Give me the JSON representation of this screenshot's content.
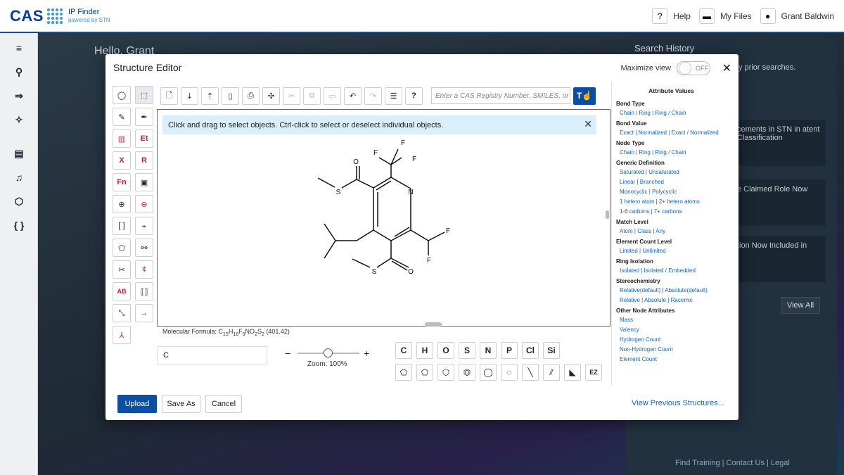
{
  "app": {
    "logo_text": "CAS",
    "product": "IP Finder",
    "powered": "powered by STN"
  },
  "topbar": {
    "help": "Help",
    "files": "My Files",
    "user": "Grant Baldwin"
  },
  "sidebar_icons": [
    "menu-icon",
    "search-icon",
    "arrow-icon",
    "network-icon",
    "doc-icon",
    "bell-icon",
    "hex-icon",
    "braces-icon"
  ],
  "background": {
    "hello": "Hello, Grant",
    "search_history": "Search History",
    "prior_text": "y prior searches.",
    "card1": "cements in STN in atent Classification",
    "card2": "e Claimed Role Now",
    "card3": "tion Now Included in",
    "view_all": "View All",
    "footer": "Find Training | Contact Us | Legal"
  },
  "dialog": {
    "title": "Structure Editor",
    "maximize_label": "Maximize view",
    "toggle_state": "OFF",
    "input_placeholder": "Enter a CAS Registry Number, SMILES, or In",
    "info_message": "Click and drag to select objects. Ctrl-click to select or deselect individual objects.",
    "molecular_formula_prefix": "Molecular Formula: C",
    "molecular_formula_parts": {
      "c": "15",
      "h": "16",
      "f": "5",
      "mw": "(401.42)"
    },
    "atom_input_value": "C",
    "zoom_label": "Zoom: 100%",
    "atoms": [
      "C",
      "H",
      "O",
      "S",
      "N",
      "P",
      "Cl",
      "Si"
    ],
    "buttons": {
      "upload": "Upload",
      "save_as": "Save As",
      "cancel": "Cancel",
      "view_previous": "View Previous Structures..."
    }
  },
  "left_tools": [
    "lasso",
    "select",
    "pencil",
    "pen",
    "chart",
    "Et",
    "X",
    "R",
    "Fn",
    "frame",
    "plus",
    "minus",
    "bracket",
    "chain",
    "ring",
    "bond",
    "scissors",
    "cent",
    "AB",
    "reaction",
    "diag-arrow",
    "arrow",
    "axis"
  ],
  "attributes": {
    "title": "Attribute Values",
    "sections": [
      {
        "name": "Bond Type",
        "lines": [
          "Chain | Ring | Ring / Chain"
        ]
      },
      {
        "name": "Bond Value",
        "lines": [
          "Exact | Normalized | Exact / Normalized"
        ]
      },
      {
        "name": "Node Type",
        "lines": [
          "Chain | Ring | Ring / Chain"
        ]
      },
      {
        "name": "Generic Definition",
        "lines": [
          "Saturated | Unsaturated",
          "Linear | Branched",
          "Monocyclic | Polycyclic",
          "1 hetero atom | 2+ hetero atoms",
          "1-6 carbons | 7+ carbons"
        ]
      },
      {
        "name": "Match Level",
        "lines": [
          "Atom | Class | Any"
        ]
      },
      {
        "name": "Element Count Level",
        "lines": [
          "Limited | Unlimited"
        ]
      },
      {
        "name": "Ring Isolation",
        "lines": [
          "Isolated | Isolated / Embedded"
        ]
      },
      {
        "name": "Stereochemistry",
        "lines": [
          "Relative(default) | Absolute(default)",
          "Relative | Absolute | Racemic"
        ]
      },
      {
        "name": "Other Node Attributes",
        "lines": [
          "Mass",
          "Valency",
          "Hydrogen Count",
          "Non-Hydrogen Count",
          "Element Count"
        ]
      }
    ]
  },
  "molecule_labels": {
    "O1": "O",
    "S1": "S",
    "N": "N",
    "F1": "F",
    "F2": "F",
    "F3": "F",
    "F4": "F",
    "F5": "F",
    "S2": "S",
    "O2": "O"
  }
}
